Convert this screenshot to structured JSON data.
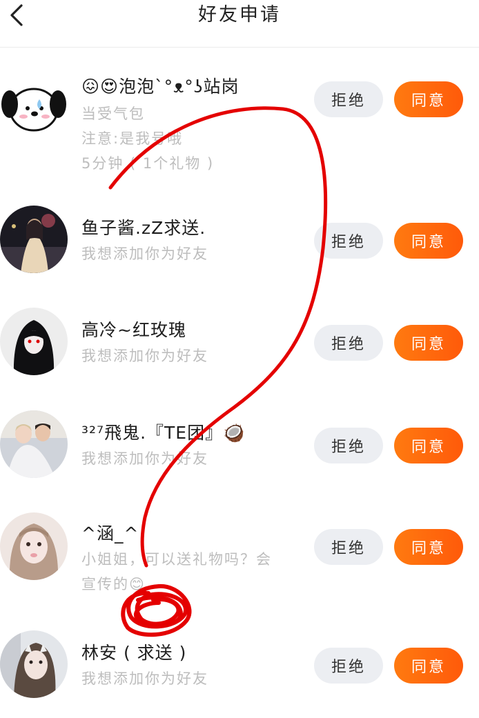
{
  "header": {
    "title": "好友申请",
    "back_icon": "chevron-left-icon"
  },
  "buttons": {
    "reject_label": "拒绝",
    "accept_label": "同意"
  },
  "requests": [
    {
      "name": "😖😍泡泡ˋ°ᴥ°ʖ站岗",
      "lines": [
        "当受气包",
        "注意:是我号哦",
        "5分钟 ( 1个礼物 )"
      ]
    },
    {
      "name": "鱼子酱.zZ求送.",
      "lines": [
        "我想添加你为好友"
      ]
    },
    {
      "name": "高冷~红玫瑰",
      "lines": [
        "我想添加你为好友"
      ]
    },
    {
      "name": "³²⁷飛鬼.『TE团』🥥",
      "lines": [
        "我想添加你为好友"
      ]
    },
    {
      "name": "^涵_^",
      "lines": [
        "小姐姐，可以送礼物吗？会",
        "宣传的😊"
      ]
    },
    {
      "name": "林安 ( 求送 )",
      "lines": [
        "我想添加你为好友"
      ]
    }
  ],
  "colors": {
    "accent": "#ff6a0d",
    "reject_bg": "#eceef2",
    "sub_text": "#bdbdbd",
    "scribble": "#e40000"
  }
}
